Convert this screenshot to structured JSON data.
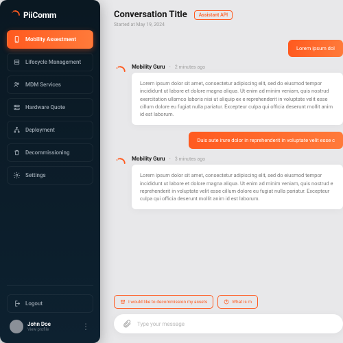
{
  "brand": {
    "name": "PiiComm"
  },
  "sidebar": {
    "items": [
      {
        "label": "Mobility Assestment",
        "icon": "device"
      },
      {
        "label": "Lifecycle Management",
        "icon": "stack"
      },
      {
        "label": "MDM Services",
        "icon": "people"
      },
      {
        "label": "Hardware Quote",
        "icon": "server"
      },
      {
        "label": "Deployment",
        "icon": "hierarchy"
      },
      {
        "label": "Decommissioning",
        "icon": "trash"
      },
      {
        "label": "Settings",
        "icon": "gear"
      }
    ],
    "logout_label": "Logout"
  },
  "profile": {
    "name": "John Doe",
    "sub": "View profile"
  },
  "header": {
    "title": "Conversation Title",
    "chip": "Assistant API",
    "sub": "Started at May 19, 2024"
  },
  "thread": {
    "user1": "Lorem ipsum dol",
    "bot1": {
      "author": "Mobility Guru",
      "time": "2 minutes ago",
      "body": "Lorem ipsum dolor sit amet, consectetur adipiscing elit, sed do eiusmod tempor incididunt ut labore et dolore magna aliqua. Ut enim ad minim veniam, quis nostrud exercitation ullamco laboris nisi ut aliquip ex e reprehenderit in voluptate velit esse cillum dolore eu fugiat nulla pariatur. Excepteur culpa qui officia deserunt mollit anim id est laborum."
    },
    "user2": "Duis aute irure dolor in reprehenderit in voluptate velit esse c",
    "bot2": {
      "author": "Mobility Guru",
      "time": "3 minutes ago",
      "body": "Lorem ipsum dolor sit amet, consectetur adipiscing elit, sed do eiusmod tempor incididunt ut labore et dolore magna aliqua. Ut enim ad minim veniam, quis nostrud e reprehenderit in voluptate velit esse cillum dolore eu fugiat nulla pariatur. Excepteur culpa qui officia deserunt mollit anim id est laborum."
    }
  },
  "suggestions": {
    "s1": "I would like to decommission my assets",
    "s2": "What is m"
  },
  "composer": {
    "placeholder": "Type your message"
  }
}
